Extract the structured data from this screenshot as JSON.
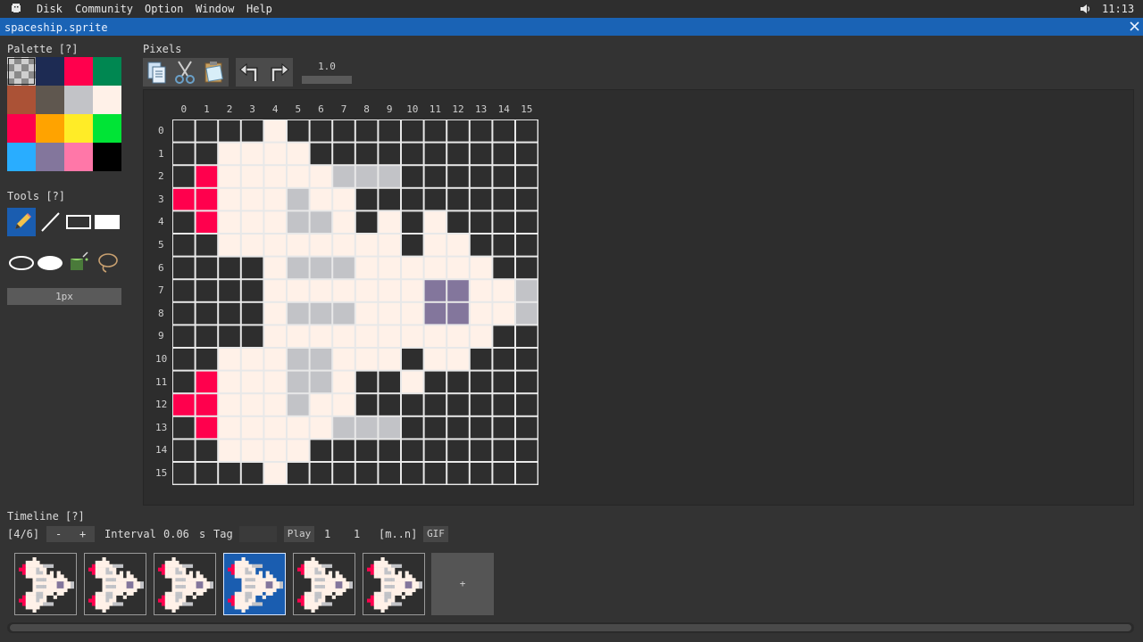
{
  "menubar": {
    "items": [
      "Disk",
      "Community",
      "Option",
      "Window",
      "Help"
    ],
    "clock": "11:13",
    "icons": [
      "app-logo-icon",
      "speaker-icon"
    ]
  },
  "window": {
    "title": "spaceship.sprite",
    "close_icon": "close-icon"
  },
  "palette": {
    "title": "Palette [?]",
    "colors": [
      "transparent",
      "#1d2b53",
      "#ff004d",
      "#008751",
      "#ab5236",
      "#5f574f",
      "#c2c3c7",
      "#fff1e8",
      "#ff004d",
      "#ffa300",
      "#ffec27",
      "#00e436",
      "#29adff",
      "#83769c",
      "#ff77a8",
      "#000000"
    ]
  },
  "tools": {
    "title": "Tools [?]",
    "items": [
      "pencil-icon",
      "line-icon",
      "rect-outline-icon",
      "rect-fill-icon",
      "ellipse-outline-icon",
      "ellipse-fill-icon",
      "bucket-icon",
      "lasso-icon"
    ],
    "brush_size": "1px"
  },
  "pixels": {
    "title": "Pixels",
    "toolbar_icons": [
      "copy-icon",
      "cut-icon",
      "paste-icon",
      "undo-icon",
      "redo-icon"
    ],
    "zoom": "1.0",
    "col_labels": [
      "0",
      "1",
      "2",
      "3",
      "4",
      "5",
      "6",
      "7",
      "8",
      "9",
      "10",
      "11",
      "12",
      "13",
      "14",
      "15"
    ],
    "row_labels": [
      "0",
      "1",
      "2",
      "3",
      "4",
      "5",
      "6",
      "7",
      "8",
      "9",
      "10",
      "11",
      "12",
      "13",
      "14",
      "15"
    ]
  },
  "sprite": {
    "legend": {
      "0": "#2e2e2e",
      "1": "#fff1e8",
      "2": "#c2c3c7",
      "3": "#ff004d",
      "4": "#83769c"
    },
    "rows": [
      "0000100000000000",
      "0011110000000000",
      "0311111222000000",
      "3311121100000000",
      "0311122101010000",
      "0011111111011000",
      "0000122211111100",
      "0000111111144112",
      "0000122211144112",
      "0000111111111100",
      "0011122111011000",
      "0311122100100000",
      "3311121100000000",
      "0311111222000000",
      "0011110000000000",
      "0000100000000000"
    ]
  },
  "timeline": {
    "title": "Timeline [?]",
    "frame_pos": "[4/6]",
    "minus": "-",
    "plus": "+",
    "interval_label": "Interval",
    "interval_value": "0.06",
    "interval_unit": "s",
    "tag_label": "Tag",
    "play": "Play",
    "from": "1",
    "to": "1",
    "range": "[m..n]",
    "gif": "GIF",
    "frame_count": 6,
    "selected_frame": 4,
    "add_frame": "+"
  }
}
